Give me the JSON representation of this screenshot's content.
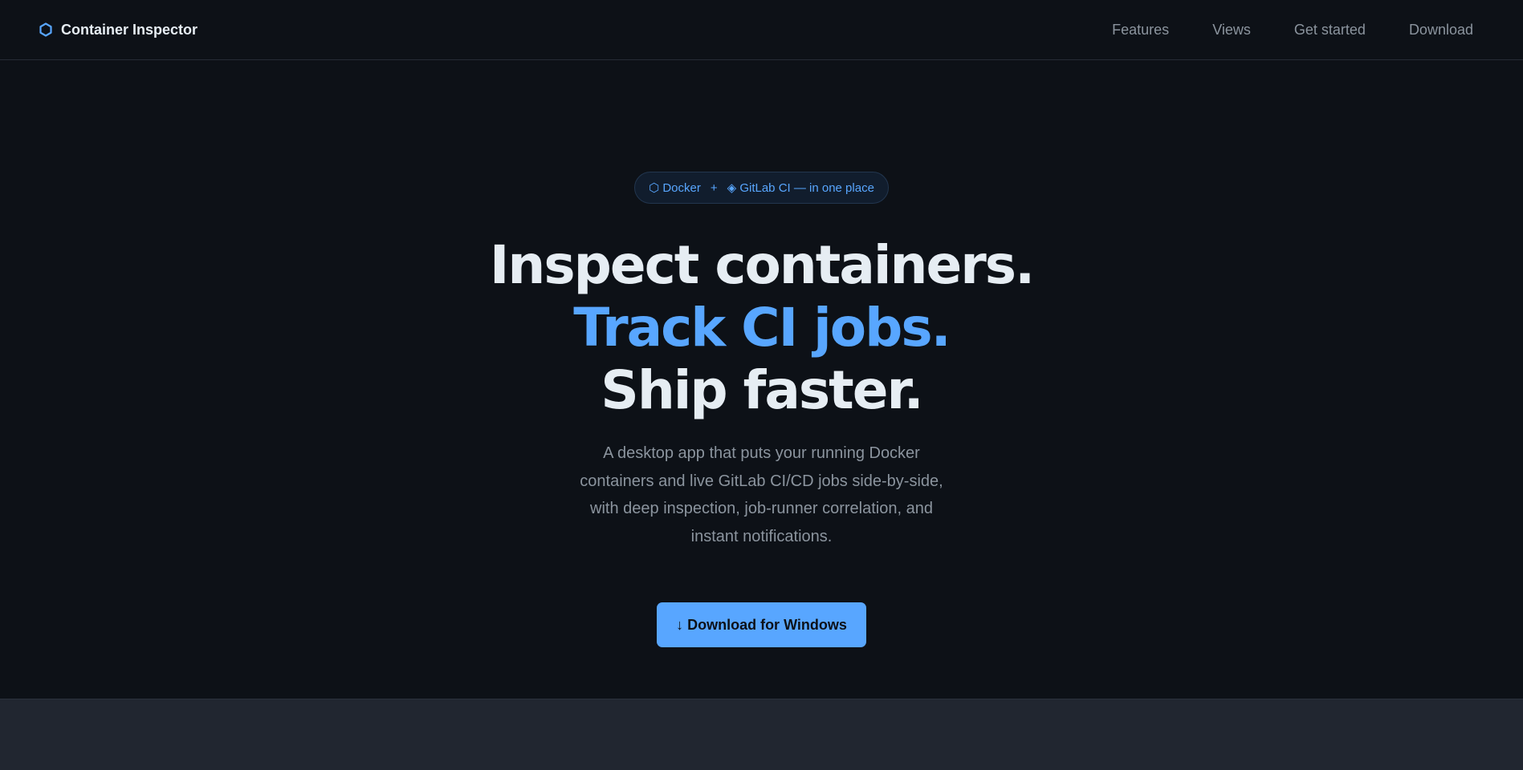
{
  "brand": {
    "icon": "hexagon-icon",
    "name": "Container Inspector"
  },
  "nav": {
    "items": [
      {
        "label": "Features"
      },
      {
        "label": "Views"
      },
      {
        "label": "Get started"
      },
      {
        "label": "Download"
      }
    ]
  },
  "badge": {
    "docker_label": "⬡ Docker",
    "plus": "+",
    "gitlab_label": "◈ GitLab CI — in one place"
  },
  "hero": {
    "line1": "Inspect containers.",
    "line2": "Track CI jobs.",
    "line3": "Ship faster.",
    "subtitle": "A desktop app that puts your running Docker containers and live GitLab CI/CD jobs side-by-side, with deep inspection, job-runner correlation, and instant notifications.",
    "cta_label": "↓ Download for Windows"
  },
  "colors": {
    "background": "#0d1117",
    "accent": "#58a6ff",
    "text": "#e6edf3",
    "muted": "#8b949e",
    "lower_band": "#212630"
  }
}
